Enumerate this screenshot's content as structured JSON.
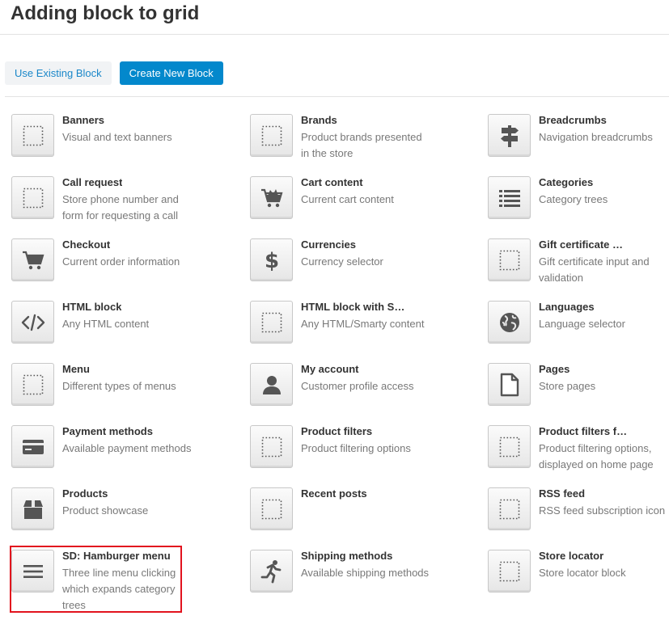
{
  "page": {
    "title": "Adding block to grid"
  },
  "tabs": [
    {
      "label": "Use Existing Block",
      "active": false
    },
    {
      "label": "Create New Block",
      "active": true
    }
  ],
  "blocks": [
    {
      "name": "Banners",
      "desc": "Visual and text banners",
      "icon": "placeholder-icon"
    },
    {
      "name": "Brands",
      "desc": "Product brands presented in the store",
      "icon": "placeholder-icon"
    },
    {
      "name": "Breadcrumbs",
      "desc": "Navigation breadcrumbs",
      "icon": "signpost-icon"
    },
    {
      "name": "Call request",
      "desc": "Store phone number and form for requesting a call",
      "icon": "placeholder-icon"
    },
    {
      "name": "Cart content",
      "desc": "Current cart content",
      "icon": "cart-full-icon"
    },
    {
      "name": "Categories",
      "desc": "Category trees",
      "icon": "list-icon"
    },
    {
      "name": "Checkout",
      "desc": "Current order information",
      "icon": "cart-icon"
    },
    {
      "name": "Currencies",
      "desc": "Currency selector",
      "icon": "dollar-icon"
    },
    {
      "name": "Gift certificate …",
      "desc": "Gift certificate input and validation",
      "icon": "placeholder-icon"
    },
    {
      "name": "HTML block",
      "desc": "Any HTML content",
      "icon": "code-icon"
    },
    {
      "name": "HTML block with S…",
      "desc": "Any HTML/Smarty content",
      "icon": "placeholder-icon"
    },
    {
      "name": "Languages",
      "desc": "Language selector",
      "icon": "globe-icon"
    },
    {
      "name": "Menu",
      "desc": "Different types of menus",
      "icon": "placeholder-icon"
    },
    {
      "name": "My account",
      "desc": "Customer profile access",
      "icon": "user-icon"
    },
    {
      "name": "Pages",
      "desc": "Store pages",
      "icon": "page-icon"
    },
    {
      "name": "Payment methods",
      "desc": "Available payment methods",
      "icon": "credit-card-icon"
    },
    {
      "name": "Product filters",
      "desc": "Product filtering options",
      "icon": "placeholder-icon"
    },
    {
      "name": "Product filters f…",
      "desc": "Product filtering options, displayed on home page",
      "icon": "placeholder-icon"
    },
    {
      "name": "Products",
      "desc": "Product showcase",
      "icon": "box-icon"
    },
    {
      "name": "Recent posts",
      "desc": "",
      "icon": "placeholder-icon"
    },
    {
      "name": "RSS feed",
      "desc": "RSS feed subscription icon",
      "icon": "placeholder-icon"
    },
    {
      "name": "SD: Hamburger menu",
      "desc": "Three line menu clicking which expands category trees",
      "icon": "hamburger-icon"
    },
    {
      "name": "Shipping methods",
      "desc": "Available shipping methods",
      "icon": "runner-icon"
    },
    {
      "name": "Store locator",
      "desc": "Store locator block",
      "icon": "placeholder-icon"
    }
  ],
  "highlighted_block": "SD: Hamburger menu",
  "colors": {
    "accent": "#0388cc",
    "link": "#1a87c9",
    "highlight_border": "#e2131e",
    "icon": "#555555"
  }
}
